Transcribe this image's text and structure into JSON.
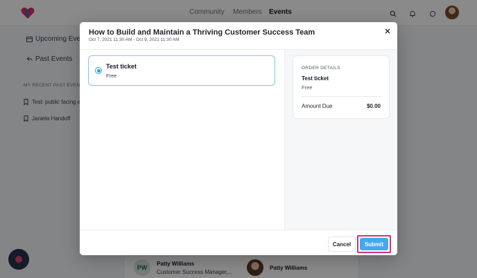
{
  "app": {
    "nav": {
      "community": "Community",
      "members": "Members",
      "events": "Events"
    }
  },
  "sidebar": {
    "upcoming": "Upcoming Events",
    "past": "Past Events",
    "recent_heading": "MY RECENT PAST EVENTS",
    "recent_items": [
      "Test: public facing e",
      "Janiela Handoff"
    ]
  },
  "background_people": [
    {
      "initials": "PW",
      "name": "Patty Williams",
      "role": "Customer Success Manager,..."
    },
    {
      "name": "Patty Williams"
    }
  ],
  "modal": {
    "title": "How to Build and Maintain a Thriving Customer Success Team",
    "date_range": "Oct 7, 2021 11:30 AM - Oct 9, 2021 11:30 AM",
    "ticket": {
      "name": "Test ticket",
      "price": "Free",
      "selected": true
    },
    "order": {
      "heading": "ORDER DETAILS",
      "ticket_name": "Test ticket",
      "ticket_price": "Free",
      "amount_due_label": "Amount Due",
      "amount_due_value": "$0.00"
    },
    "buttons": {
      "cancel": "Cancel",
      "submit": "Submit"
    }
  },
  "colors": {
    "accent": "#44a8f0",
    "highlight": "#d62e78",
    "selected_border": "#7cc2ef"
  },
  "icons": [
    "logo-heart-icon",
    "search-icon",
    "bell-icon",
    "chat-icon",
    "calendar-icon",
    "back-arrow-icon",
    "bookmark-icon",
    "close-icon"
  ]
}
